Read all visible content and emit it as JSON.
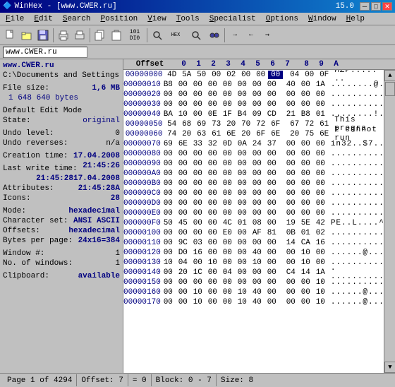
{
  "titlebar": {
    "title": "WinHex - [www.CWER.ru]",
    "version": "15.0",
    "minimize": "─",
    "maximize": "□",
    "close": "✕"
  },
  "menu": {
    "items": [
      {
        "label": "File",
        "underline": "F"
      },
      {
        "label": "Edit",
        "underline": "E"
      },
      {
        "label": "Search",
        "underline": "S"
      },
      {
        "label": "Position",
        "underline": "P"
      },
      {
        "label": "View",
        "underline": "V"
      },
      {
        "label": "Tools",
        "underline": "T"
      },
      {
        "label": "Specialist",
        "underline": "S"
      },
      {
        "label": "Options",
        "underline": "O"
      },
      {
        "label": "Window",
        "underline": "W"
      },
      {
        "label": "Help",
        "underline": "H"
      }
    ]
  },
  "address_bar": {
    "value": "www.CWER.ru"
  },
  "left_panel": {
    "filename": "www.CWER.ru",
    "path": "C:\\Documents and Settings",
    "file_size_label": "File size:",
    "file_size_mb": "1,6 MB",
    "file_size_bytes": "1 648 640 bytes",
    "edit_mode_label": "Default Edit Mode",
    "state_label": "State:",
    "state_value": "original",
    "undo_level_label": "Undo level:",
    "undo_level_value": "0",
    "undo_reverses_label": "Undo reverses:",
    "undo_reverses_value": "n/a",
    "creation_time_label": "Creation time:",
    "creation_time_date": "17.04.2008",
    "creation_time_time": "21:45:26",
    "last_write_label": "Last write time:",
    "last_write_date": "17.04.2008",
    "last_write_time": "21:45:28",
    "attributes_label": "Attributes:",
    "attributes_value": "21:45:28A",
    "icons_label": "Icons:",
    "icons_value": "28",
    "mode_label": "Mode:",
    "mode_value": "hexadecimal",
    "charset_label": "Character set:",
    "charset_value": "ANSI ASCII",
    "offsets_label": "Offsets:",
    "offsets_value": "hexadecimal",
    "bytes_per_page_label": "Bytes per page:",
    "bytes_per_page_value": "24x16=384",
    "window_num_label": "Window #:",
    "window_num_value": "1",
    "no_of_windows_label": "No. of windows:",
    "no_of_windows_value": "1",
    "clipboard_label": "Clipboard:",
    "clipboard_value": "available"
  },
  "hex_view": {
    "header": {
      "offset_label": "Offset",
      "columns": [
        "0",
        "1",
        "2",
        "3",
        "4",
        "5",
        "6",
        "7",
        "",
        "8",
        "9",
        "A"
      ],
      "ascii_label": "A"
    },
    "rows": [
      {
        "offset": "00000000",
        "bytes": [
          "4D",
          "5A",
          "50",
          "00",
          "02",
          "00",
          "00",
          "00",
          "04",
          "00",
          "0F"
        ],
        "highlighted": [
          7
        ],
        "ascii": "MZP.....  .."
      },
      {
        "offset": "00000010",
        "bytes": [
          "B8",
          "00",
          "00",
          "00",
          "00",
          "00",
          "00",
          "00",
          "40",
          "00",
          "1A"
        ],
        "highlighted": [],
        "ascii": "........@..."
      },
      {
        "offset": "00000020",
        "bytes": [
          "00",
          "00",
          "00",
          "00",
          "00",
          "00",
          "00",
          "00",
          "00",
          "00",
          "00"
        ],
        "highlighted": [],
        "ascii": "..........."
      },
      {
        "offset": "00000030",
        "bytes": [
          "00",
          "00",
          "00",
          "00",
          "00",
          "00",
          "00",
          "00",
          "00",
          "00",
          "00"
        ],
        "highlighted": [],
        "ascii": "..........."
      },
      {
        "offset": "00000040",
        "bytes": [
          "BA",
          "10",
          "00",
          "0E",
          "1F",
          "B4",
          "09",
          "CD",
          "21",
          "B8",
          "01"
        ],
        "highlighted": [],
        "ascii": "........!..."
      },
      {
        "offset": "00000050",
        "bytes": [
          "54",
          "68",
          "69",
          "73",
          "20",
          "70",
          "72",
          "6F",
          "67",
          "72",
          "61"
        ],
        "highlighted": [],
        "ascii": "This progra"
      },
      {
        "offset": "00000060",
        "bytes": [
          "74",
          "20",
          "63",
          "61",
          "6E",
          "20",
          "6F",
          "6E",
          "20",
          "75",
          "6E"
        ],
        "highlighted": [],
        "ascii": "t cannot run"
      },
      {
        "offset": "00000070",
        "bytes": [
          "69",
          "6E",
          "33",
          "32",
          "0D",
          "0A",
          "24",
          "37",
          "00",
          "00",
          "00"
        ],
        "highlighted": [],
        "ascii": "in32..$7..."
      },
      {
        "offset": "00000080",
        "bytes": [
          "00",
          "00",
          "00",
          "00",
          "00",
          "00",
          "00",
          "00",
          "00",
          "00",
          "00"
        ],
        "highlighted": [],
        "ascii": "..........."
      },
      {
        "offset": "00000090",
        "bytes": [
          "00",
          "00",
          "00",
          "00",
          "00",
          "00",
          "00",
          "00",
          "00",
          "00",
          "00"
        ],
        "highlighted": [],
        "ascii": "..........."
      },
      {
        "offset": "000000A0",
        "bytes": [
          "00",
          "00",
          "00",
          "00",
          "00",
          "00",
          "00",
          "00",
          "00",
          "00",
          "00"
        ],
        "highlighted": [],
        "ascii": "..........."
      },
      {
        "offset": "000000B0",
        "bytes": [
          "00",
          "00",
          "00",
          "00",
          "00",
          "00",
          "00",
          "00",
          "00",
          "00",
          "00"
        ],
        "highlighted": [],
        "ascii": "..........."
      },
      {
        "offset": "000000C0",
        "bytes": [
          "00",
          "00",
          "00",
          "00",
          "00",
          "00",
          "00",
          "00",
          "00",
          "00",
          "00"
        ],
        "highlighted": [],
        "ascii": "..........."
      },
      {
        "offset": "000000D0",
        "bytes": [
          "00",
          "00",
          "00",
          "00",
          "00",
          "00",
          "00",
          "00",
          "00",
          "00",
          "00"
        ],
        "highlighted": [],
        "ascii": "..........."
      },
      {
        "offset": "000000E0",
        "bytes": [
          "00",
          "00",
          "00",
          "00",
          "00",
          "00",
          "00",
          "00",
          "00",
          "00",
          "00"
        ],
        "highlighted": [],
        "ascii": "..........."
      },
      {
        "offset": "000000F0",
        "bytes": [
          "50",
          "45",
          "00",
          "00",
          "4C",
          "01",
          "08",
          "00",
          "19",
          "5E",
          "42"
        ],
        "highlighted": [],
        "ascii": "PE..L....^B"
      },
      {
        "offset": "00000100",
        "bytes": [
          "00",
          "00",
          "00",
          "00",
          "E0",
          "00",
          "AF",
          "81",
          "0B",
          "01",
          "02"
        ],
        "highlighted": [],
        "ascii": "........... "
      },
      {
        "offset": "00000110",
        "bytes": [
          "00",
          "9C",
          "03",
          "00",
          "00",
          "00",
          "00",
          "00",
          "14",
          "CA",
          "16"
        ],
        "highlighted": [],
        "ascii": "..........."
      },
      {
        "offset": "00000120",
        "bytes": [
          "00",
          "D0",
          "16",
          "00",
          "00",
          "00",
          "40",
          "00",
          "00",
          "10",
          "00"
        ],
        "highlighted": [],
        "ascii": "......@...."
      },
      {
        "offset": "00000130",
        "bytes": [
          "10",
          "04",
          "00",
          "10",
          "00",
          "00",
          "10",
          "00",
          "00",
          "10",
          "00"
        ],
        "highlighted": [],
        "ascii": "..........."
      },
      {
        "offset": "00000140",
        "bytes": [
          "00",
          "20",
          "1C",
          "00",
          "04",
          "00",
          "00",
          "00",
          "C4",
          "14",
          "1A"
        ],
        "highlighted": [],
        "ascii": ". .........."
      },
      {
        "offset": "00000150",
        "bytes": [
          "00",
          "00",
          "00",
          "00",
          "00",
          "00",
          "00",
          "00",
          "00",
          "00",
          "10"
        ],
        "highlighted": [],
        "ascii": "..........."
      },
      {
        "offset": "00000160",
        "bytes": [
          "00",
          "00",
          "10",
          "00",
          "00",
          "10",
          "40",
          "00",
          "00",
          "00",
          "10"
        ],
        "highlighted": [],
        "ascii": "......@...."
      },
      {
        "offset": "00000170",
        "bytes": [
          "00",
          "00",
          "10",
          "00",
          "00",
          "10",
          "40",
          "00",
          "00",
          "00",
          "10"
        ],
        "highlighted": [],
        "ascii": "......@...."
      }
    ]
  },
  "status_bar": {
    "page": "Page 1 of 4294",
    "offset_label": "Offset:",
    "offset_value": "7",
    "equals_label": "= 0",
    "block_label": "Block:",
    "block_value": "0 - 7",
    "size_label": "Size:",
    "size_value": "8"
  }
}
